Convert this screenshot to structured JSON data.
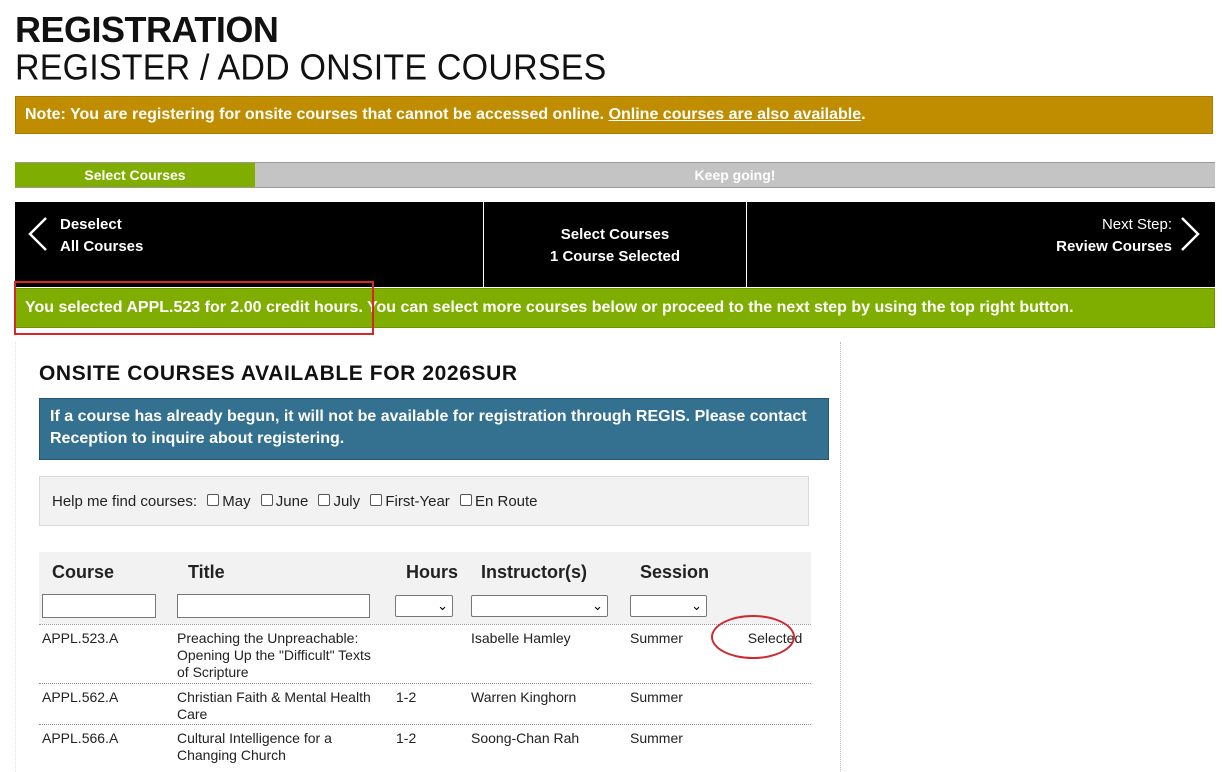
{
  "header": {
    "title": "REGISTRATION",
    "subtitle": "REGISTER / ADD ONSITE COURSES"
  },
  "note": {
    "text": "Note: You are registering for onsite courses that cannot be accessed online. ",
    "link": "Online courses are also available",
    "suffix": "."
  },
  "progress": {
    "current": "Select Courses",
    "next": "Keep going!"
  },
  "nav": {
    "left_line1": "Deselect",
    "left_line2": "All Courses",
    "mid_line1": "Select Courses",
    "mid_line2": "1 Course Selected",
    "right_line1": "Next Step:",
    "right_line2": "Review Courses"
  },
  "success": {
    "text": "You selected APPL.523 for 2.00 credit hours. You can select more courses below or proceed to the next step by using the top right button."
  },
  "panel": {
    "title": "ONSITE COURSES AVAILABLE FOR 2026SUR",
    "info": "If a course has already begun, it will not be available for registration through REGIS. Please contact Reception to inquire about registering.",
    "filter_label": "Help me find courses:",
    "filters": [
      "May",
      "June",
      "July",
      "First-Year",
      "En Route"
    ]
  },
  "table": {
    "headers": {
      "course": "Course",
      "title": "Title",
      "hours": "Hours",
      "instructor": "Instructor(s)",
      "session": "Session"
    },
    "rows": [
      {
        "course": "APPL.523.A",
        "title": "Preaching the Unpreachable: Opening Up the \"Difficult\" Texts of Scripture",
        "hours": "",
        "instructor": "Isabelle Hamley",
        "session": "Summer",
        "status": "Selected"
      },
      {
        "course": "APPL.562.A",
        "title": "Christian Faith & Mental Health Care",
        "hours": "1-2",
        "instructor": "Warren Kinghorn",
        "session": "Summer",
        "status": ""
      },
      {
        "course": "APPL.566.A",
        "title": "Cultural Intelligence for a Changing Church",
        "hours": "1-2",
        "instructor": "Soong-Chan Rah",
        "session": "Summer",
        "status": ""
      }
    ]
  },
  "colors": {
    "note_bg": "#c08d00",
    "green": "#7fae00",
    "info_bg": "#34708f",
    "nav_bg": "#000000",
    "annotation_red": "#d9262c"
  }
}
